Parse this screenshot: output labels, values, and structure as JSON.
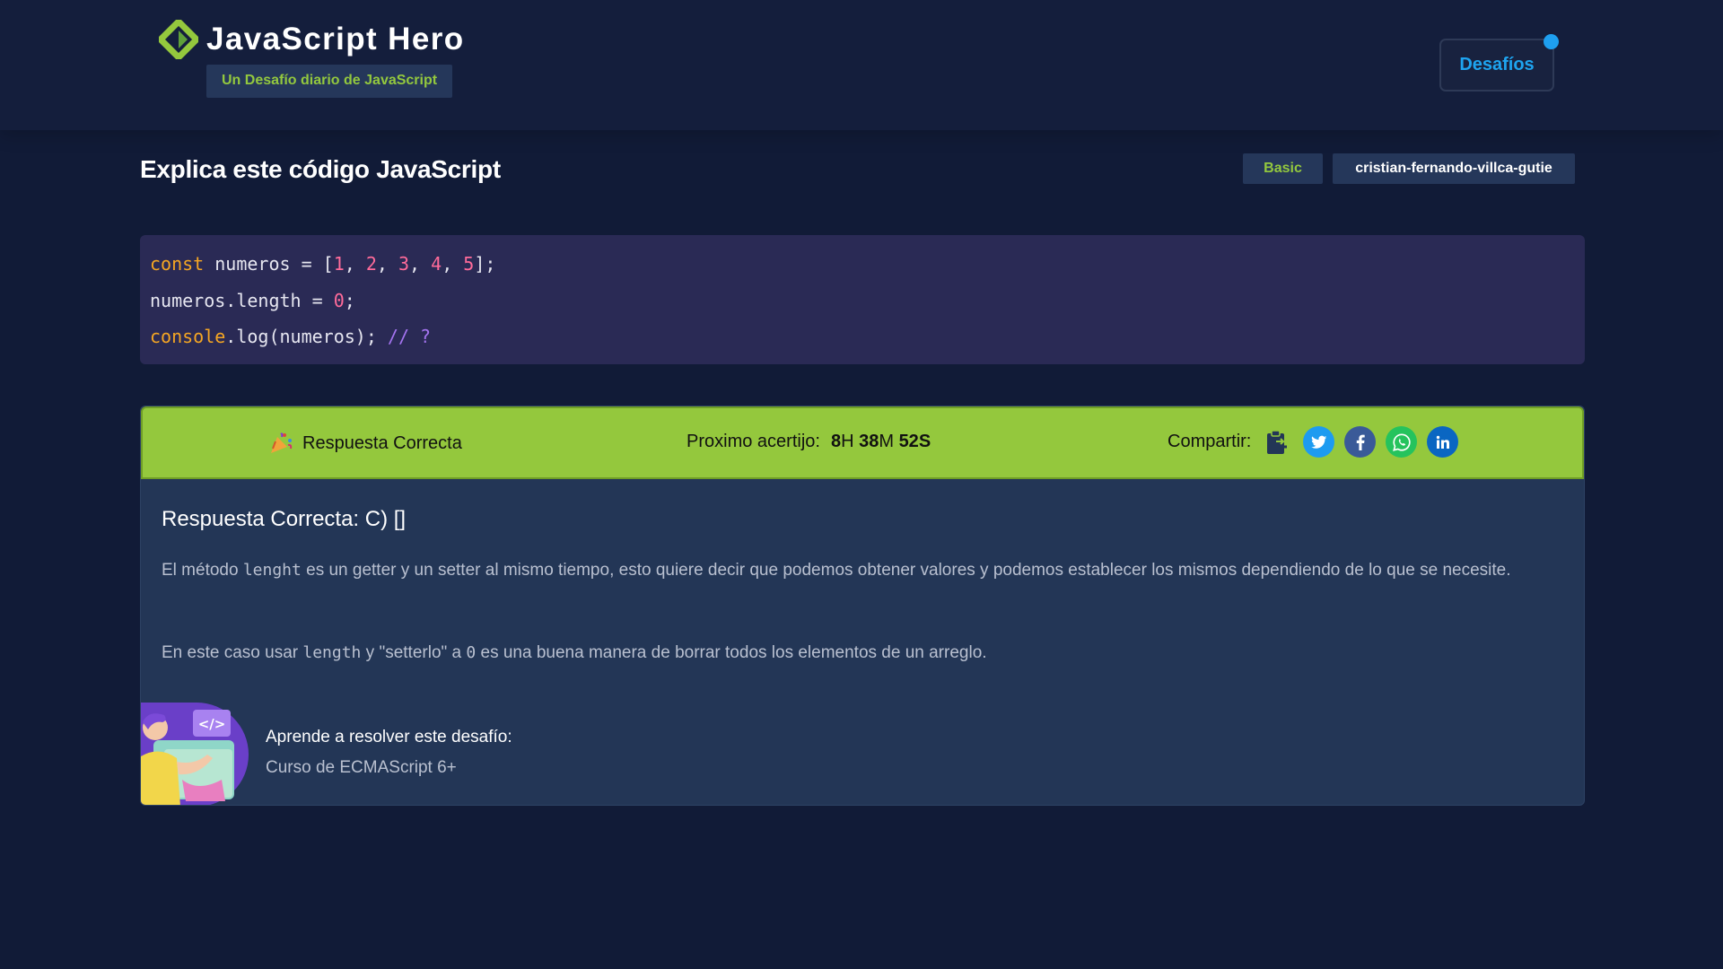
{
  "header": {
    "title": "JavaScript Hero",
    "subtitle": "Un Desafío diario de JavaScript",
    "challenges_button": "Desafíos",
    "logo_icon": "diamond-logo-icon"
  },
  "challenge": {
    "title": "Explica este código JavaScript",
    "level": "Basic",
    "author": "cristian-fernando-villca-gutie"
  },
  "code": {
    "line1": {
      "kw": "const",
      "a": " numeros = [",
      "n1": "1",
      "s1": ", ",
      "n2": "2",
      "s2": ", ",
      "n3": "3",
      "s3": ", ",
      "n4": "4",
      "s4": ", ",
      "n5": "5",
      "end": "];"
    },
    "line2": {
      "a": "numeros.length = ",
      "n": "0",
      "end": ";"
    },
    "line3": {
      "kw": "console",
      "a": ".log(numeros); ",
      "cmt": "// ?"
    }
  },
  "result": {
    "status": "Respuesta Correcta",
    "next_label": "Proximo acertijo:",
    "countdown": {
      "h": "8",
      "h_unit": "H",
      "m": "38",
      "m_unit": "M",
      "s": "52",
      "s_unit": "S"
    },
    "share_label": "Compartir:",
    "share_icons": [
      "clipboard-icon",
      "twitter-icon",
      "facebook-icon",
      "whatsapp-icon",
      "linkedin-icon"
    ]
  },
  "answer": {
    "title": "Respuesta Correcta: C) []",
    "p1": {
      "a": "El método ",
      "code": "lenght",
      "b": " es un getter y un setter al mismo tiempo, esto quiere decir que podemos obtener valores y podemos establecer los mismos dependiendo de lo que se necesite."
    },
    "p2": {
      "a": "En este caso usar ",
      "code1": "length",
      "b": " y \"setterlo\" a ",
      "code2": "0",
      "c": " es una buena manera de borrar todos los elementos de un arreglo."
    }
  },
  "course": {
    "heading": "Aprende a resolver este desafío:",
    "link": "Curso de ECMAScript 6+"
  },
  "colors": {
    "background": "#111b37",
    "accent_green": "#94c83d",
    "accent_blue": "#1ea4f0",
    "code_bg": "#2a2a55",
    "card_bg": "#233656"
  }
}
